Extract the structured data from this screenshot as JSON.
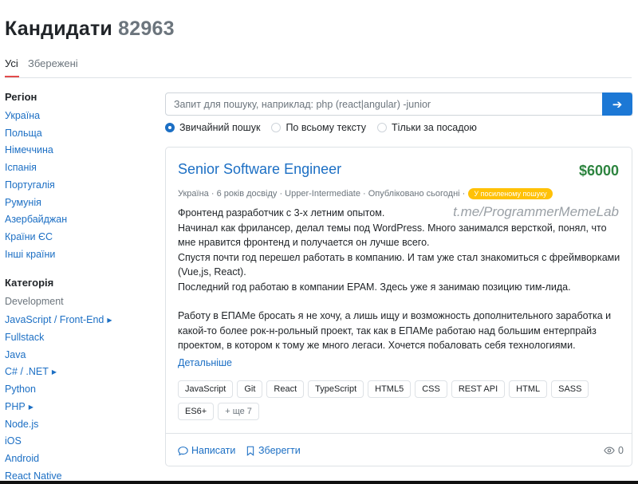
{
  "header": {
    "title": "Кандидати",
    "count": "82963"
  },
  "tabs": [
    {
      "label": "Усі",
      "active": true
    },
    {
      "label": "Збережені",
      "active": false
    }
  ],
  "sidebar": {
    "region": {
      "heading": "Регіон",
      "items": [
        "Україна",
        "Польща",
        "Німеччина",
        "Іспанія",
        "Португалія",
        "Румунія",
        "Азербайджан",
        "Країни ЄС",
        "Інші країни"
      ]
    },
    "category": {
      "heading": "Категорія",
      "subheading": "Development",
      "items": [
        {
          "label": "JavaScript / Front-End",
          "expandable": true
        },
        {
          "label": "Fullstack",
          "expandable": false
        },
        {
          "label": "Java",
          "expandable": false
        },
        {
          "label": "C# / .NET",
          "expandable": true
        },
        {
          "label": "Python",
          "expandable": false
        },
        {
          "label": "PHP",
          "expandable": true
        },
        {
          "label": "Node.js",
          "expandable": false
        },
        {
          "label": "iOS",
          "expandable": false
        },
        {
          "label": "Android",
          "expandable": false
        },
        {
          "label": "React Native",
          "expandable": false
        }
      ]
    }
  },
  "search": {
    "placeholder": "Запит для пошуку, наприклад: php (react|angular) -junior",
    "value": "",
    "button_icon": "arrow-right-icon",
    "modes": [
      {
        "label": "Звичайний пошук",
        "selected": true
      },
      {
        "label": "По всьому тексту",
        "selected": false
      },
      {
        "label": "Тільки за посадою",
        "selected": false
      }
    ]
  },
  "candidate": {
    "title": "Senior Software Engineer",
    "salary": "$6000",
    "meta": {
      "location": "Україна",
      "experience": "6 років досвіду",
      "english": "Upper-Intermediate",
      "published": "Опубліковано сьогодні",
      "badge": "У посиленому пошуку"
    },
    "watermark": "t.me/ProgrammerMemeLab",
    "description": [
      "Фронтенд разработчик с 3-х летним опытом.\nНачинал как фрилансер, делал темы под WordPress. Много занимался версткой, понял, что мне нравится фронтенд и получается он лучше всего.\nСпустя почти год перешел работать в компанию. И там уже стал знакомиться с фреймворками (Vue,js, React).\nПоследний год работаю в компании EPAM. Здесь уже я занимаю позицию тим-лида.",
      "Работу в ЕПАМе бросать я не хочу, а лишь ищу и возможность дополнительного заработка и какой-то более рок-н-рольный проект, так как в ЕПАМе работаю над большим ентерпрайз проектом, в котором к тому же много легаси. Хочется побаловать себя технологиями."
    ],
    "more_link": "Детальніше",
    "tags": [
      "JavaScript",
      "Git",
      "React",
      "TypeScript",
      "HTML5",
      "CSS",
      "REST API",
      "HTML",
      "SASS",
      "ES6+"
    ],
    "more_tags": "+ ще 7",
    "actions": {
      "write": "Написати",
      "save": "Зберегти"
    },
    "views": "0"
  },
  "colors": {
    "accent": "#1c6fc4",
    "salary": "#2e8540",
    "badge": "#ffc107",
    "tab_underline": "#e34b4b"
  }
}
